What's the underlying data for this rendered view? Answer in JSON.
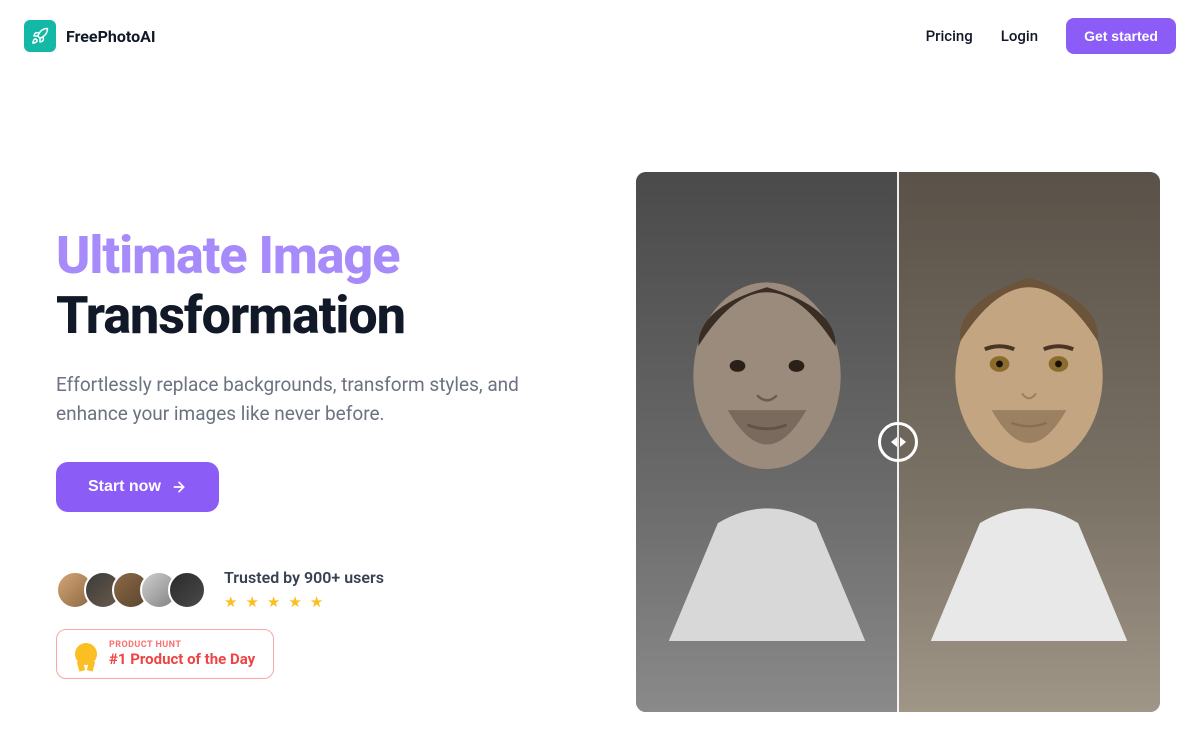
{
  "brand": {
    "name": "FreePhotoAI"
  },
  "nav": {
    "pricing": "Pricing",
    "login": "Login",
    "cta": "Get started"
  },
  "hero": {
    "title_line1": "Ultimate Image",
    "title_line2": "Transformation",
    "subtitle": "Effortlessly replace backgrounds, transform styles, and enhance your images like never before.",
    "cta": "Start now"
  },
  "social": {
    "trusted": "Trusted by 900+ users",
    "stars_count": 5,
    "avatars_count": 5
  },
  "producthunt": {
    "label": "PRODUCT HUNT",
    "title": "#1 Product of the Day"
  },
  "colors": {
    "accent": "#8b5cf6",
    "accent_light": "#a78bfa",
    "teal": "#14b8a6",
    "star": "#fbbf24",
    "ph_red": "#ef4444"
  }
}
